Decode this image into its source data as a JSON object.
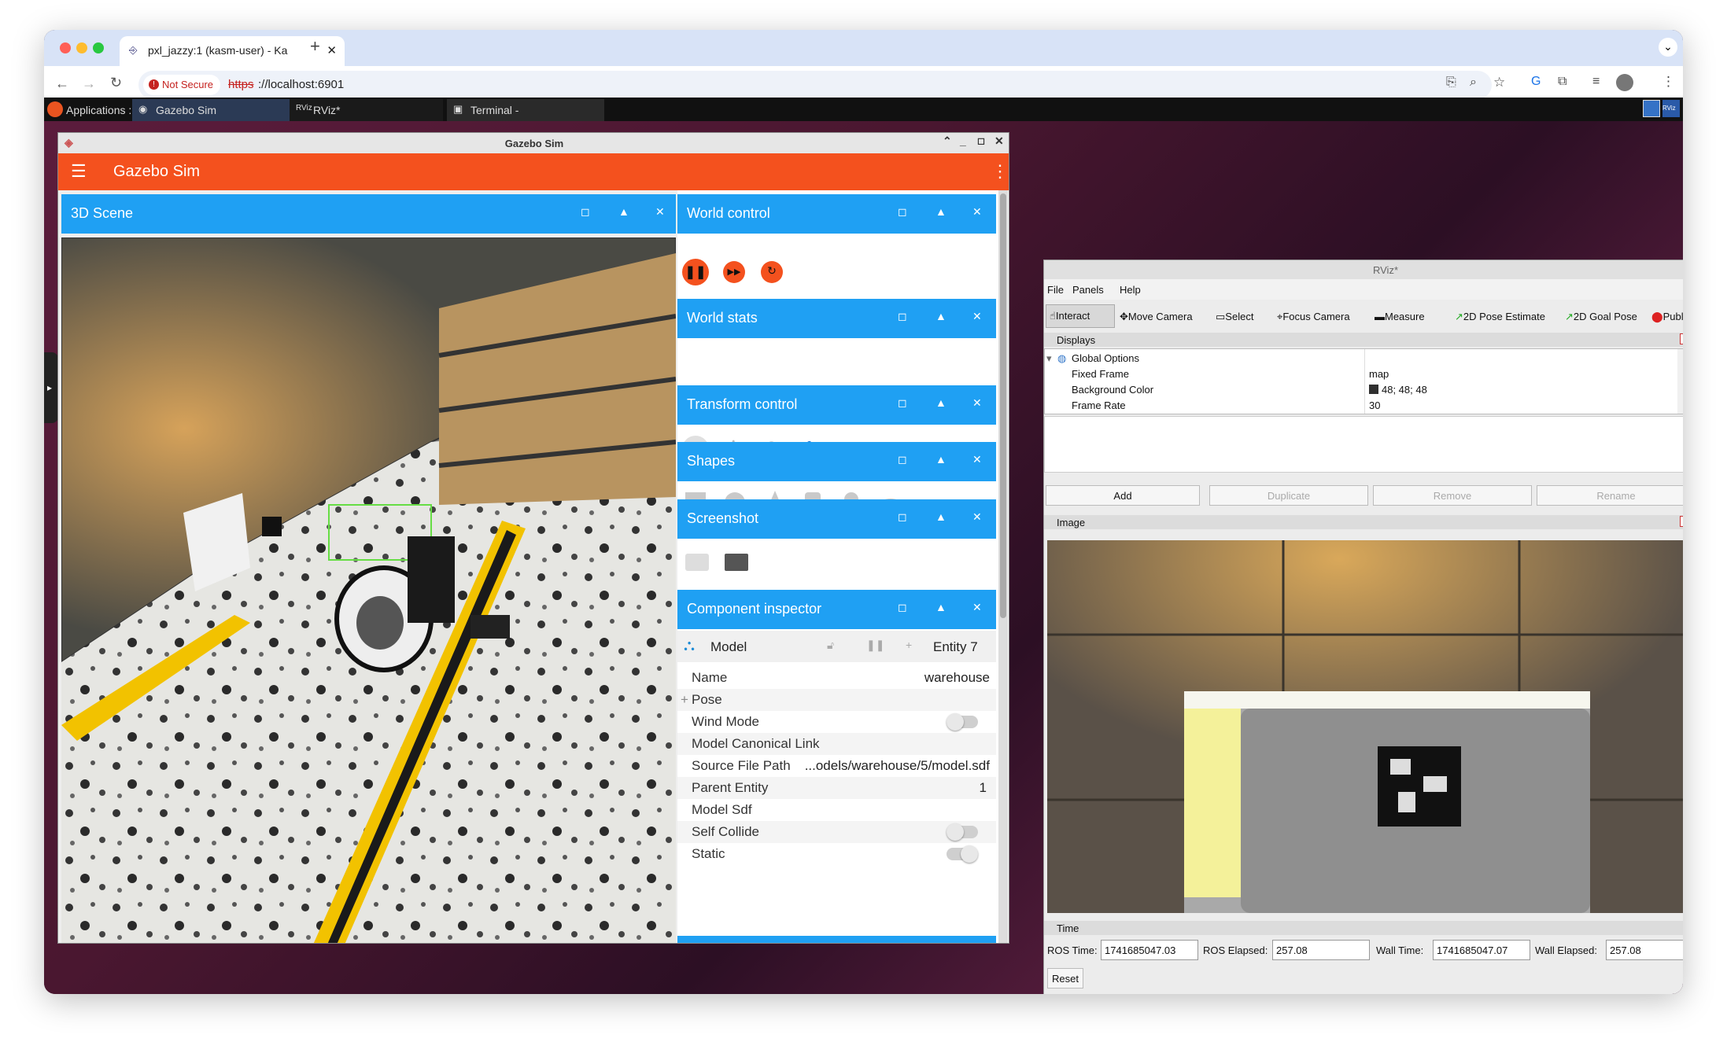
{
  "browser": {
    "tab_title": "pxl_jazzy:1 (kasm-user) - Ka",
    "security_label": "Not Secure",
    "url_scheme": "https",
    "url_rest": "://localhost:6901"
  },
  "taskbar": {
    "applications": "Applications :",
    "tasks": [
      "Gazebo Sim",
      "RViz*",
      "Terminal -"
    ]
  },
  "gazebo": {
    "window_title": "Gazebo Sim",
    "app_title": "Gazebo Sim",
    "scene_title": "3D Scene",
    "docks": {
      "world_control": "World control",
      "world_stats": "World stats",
      "transform_control": "Transform control",
      "shapes": "Shapes",
      "screenshot": "Screenshot",
      "component_inspector": "Component inspector"
    },
    "inspector": {
      "model_label": "Model",
      "entity_label": "Entity 7",
      "rows": [
        {
          "key": "Name",
          "value": "warehouse"
        },
        {
          "key": "Pose",
          "value": ""
        },
        {
          "key": "Wind Mode",
          "value": ""
        },
        {
          "key": "Model Canonical Link",
          "value": ""
        },
        {
          "key": "Source File Path",
          "value": "...odels/warehouse/5/model.sdf"
        },
        {
          "key": "Parent Entity",
          "value": "1"
        },
        {
          "key": "Model Sdf",
          "value": ""
        },
        {
          "key": "Self Collide",
          "value": ""
        },
        {
          "key": "Static",
          "value": ""
        }
      ],
      "pose_prefix": "+"
    }
  },
  "rviz": {
    "window_title": "RViz*",
    "menu": [
      "File",
      "Panels",
      "Help"
    ],
    "tools": [
      "Interact",
      "Move Camera",
      "Select",
      "Focus Camera",
      "Measure",
      "2D Pose Estimate",
      "2D Goal Pose",
      "Publish Poin"
    ],
    "displays_title": "Displays",
    "global_options": "Global Options",
    "properties": [
      {
        "key": "Fixed Frame",
        "value": "map"
      },
      {
        "key": "Background Color",
        "value": "48; 48; 48"
      },
      {
        "key": "Frame Rate",
        "value": "30"
      }
    ],
    "buttons": [
      "Add",
      "Duplicate",
      "Remove",
      "Rename"
    ],
    "image_title": "Image",
    "time_title": "Time",
    "time": {
      "ros_time_label": "ROS Time:",
      "ros_time": "1741685047.03",
      "ros_elapsed_label": "ROS Elapsed:",
      "ros_elapsed": "257.08",
      "wall_time_label": "Wall Time:",
      "wall_time": "1741685047.07",
      "wall_elapsed_label": "Wall Elapsed:",
      "wall_elapsed": "257.08"
    },
    "reset": "Reset"
  },
  "colors": {
    "gazebo_orange": "#f4511e",
    "dock_blue": "#1fa0f3",
    "desktop": "#4a1730"
  }
}
